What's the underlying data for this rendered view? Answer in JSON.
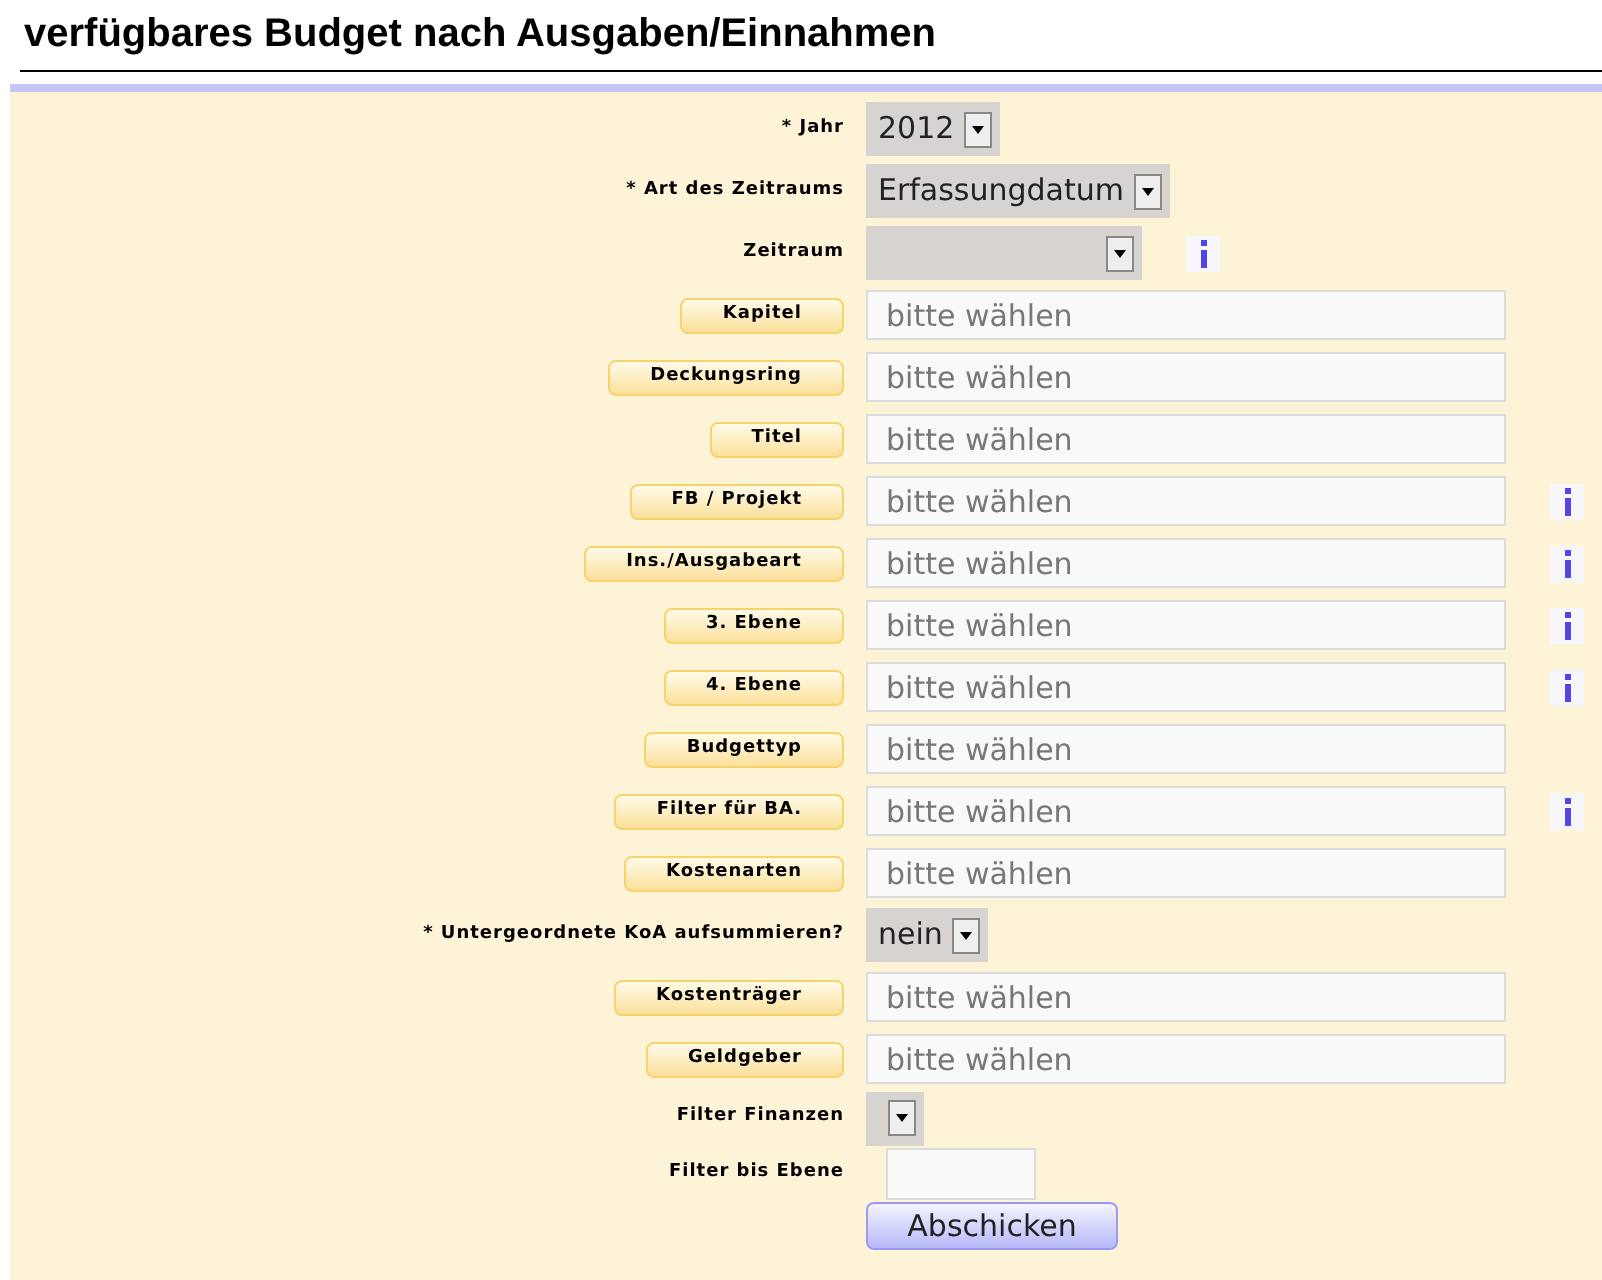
{
  "title": "verfügbares Budget nach Ausgaben/Einnahmen",
  "fields": [
    {
      "kind": "select",
      "label": "* Jahr",
      "value": "2012",
      "info": false
    },
    {
      "kind": "select",
      "label": "* Art des Zeitraums",
      "value": "Erfassungdatum",
      "info": false
    },
    {
      "kind": "select",
      "label": "Zeitraum",
      "info": true
    },
    {
      "kind": "picker",
      "label": "Kapitel",
      "placeholder": "bitte wählen",
      "info": false
    },
    {
      "kind": "picker",
      "label": "Deckungsring",
      "placeholder": "bitte wählen",
      "info": false
    },
    {
      "kind": "picker",
      "label": "Titel",
      "placeholder": "bitte wählen",
      "info": false
    },
    {
      "kind": "picker",
      "label": "FB / Projekt",
      "placeholder": "bitte wählen",
      "info": true
    },
    {
      "kind": "picker",
      "label": "Ins./Ausgabeart",
      "placeholder": "bitte wählen",
      "info": true
    },
    {
      "kind": "picker",
      "label": "3. Ebene",
      "placeholder": "bitte wählen",
      "info": true
    },
    {
      "kind": "picker",
      "label": "4. Ebene",
      "placeholder": "bitte wählen",
      "info": true
    },
    {
      "kind": "picker",
      "label": "Budgettyp",
      "placeholder": "bitte wählen",
      "info": false
    },
    {
      "kind": "picker",
      "label": "Filter für BA.",
      "placeholder": "bitte wählen",
      "info": true
    },
    {
      "kind": "picker",
      "label": "Kostenarten",
      "placeholder": "bitte wählen",
      "info": false
    },
    {
      "kind": "select",
      "label": "* Untergeordnete KoA aufsummieren?",
      "value": "nein",
      "info": false
    },
    {
      "kind": "picker",
      "label": "Kostenträger",
      "placeholder": "bitte wählen",
      "info": false
    },
    {
      "kind": "picker",
      "label": "Geldgeber",
      "placeholder": "bitte wählen",
      "info": false
    },
    {
      "kind": "select",
      "label": "Filter Finanzen",
      "info": false
    },
    {
      "kind": "text",
      "label": "Filter bis Ebene",
      "info": false
    }
  ],
  "submit": "Abschicken"
}
